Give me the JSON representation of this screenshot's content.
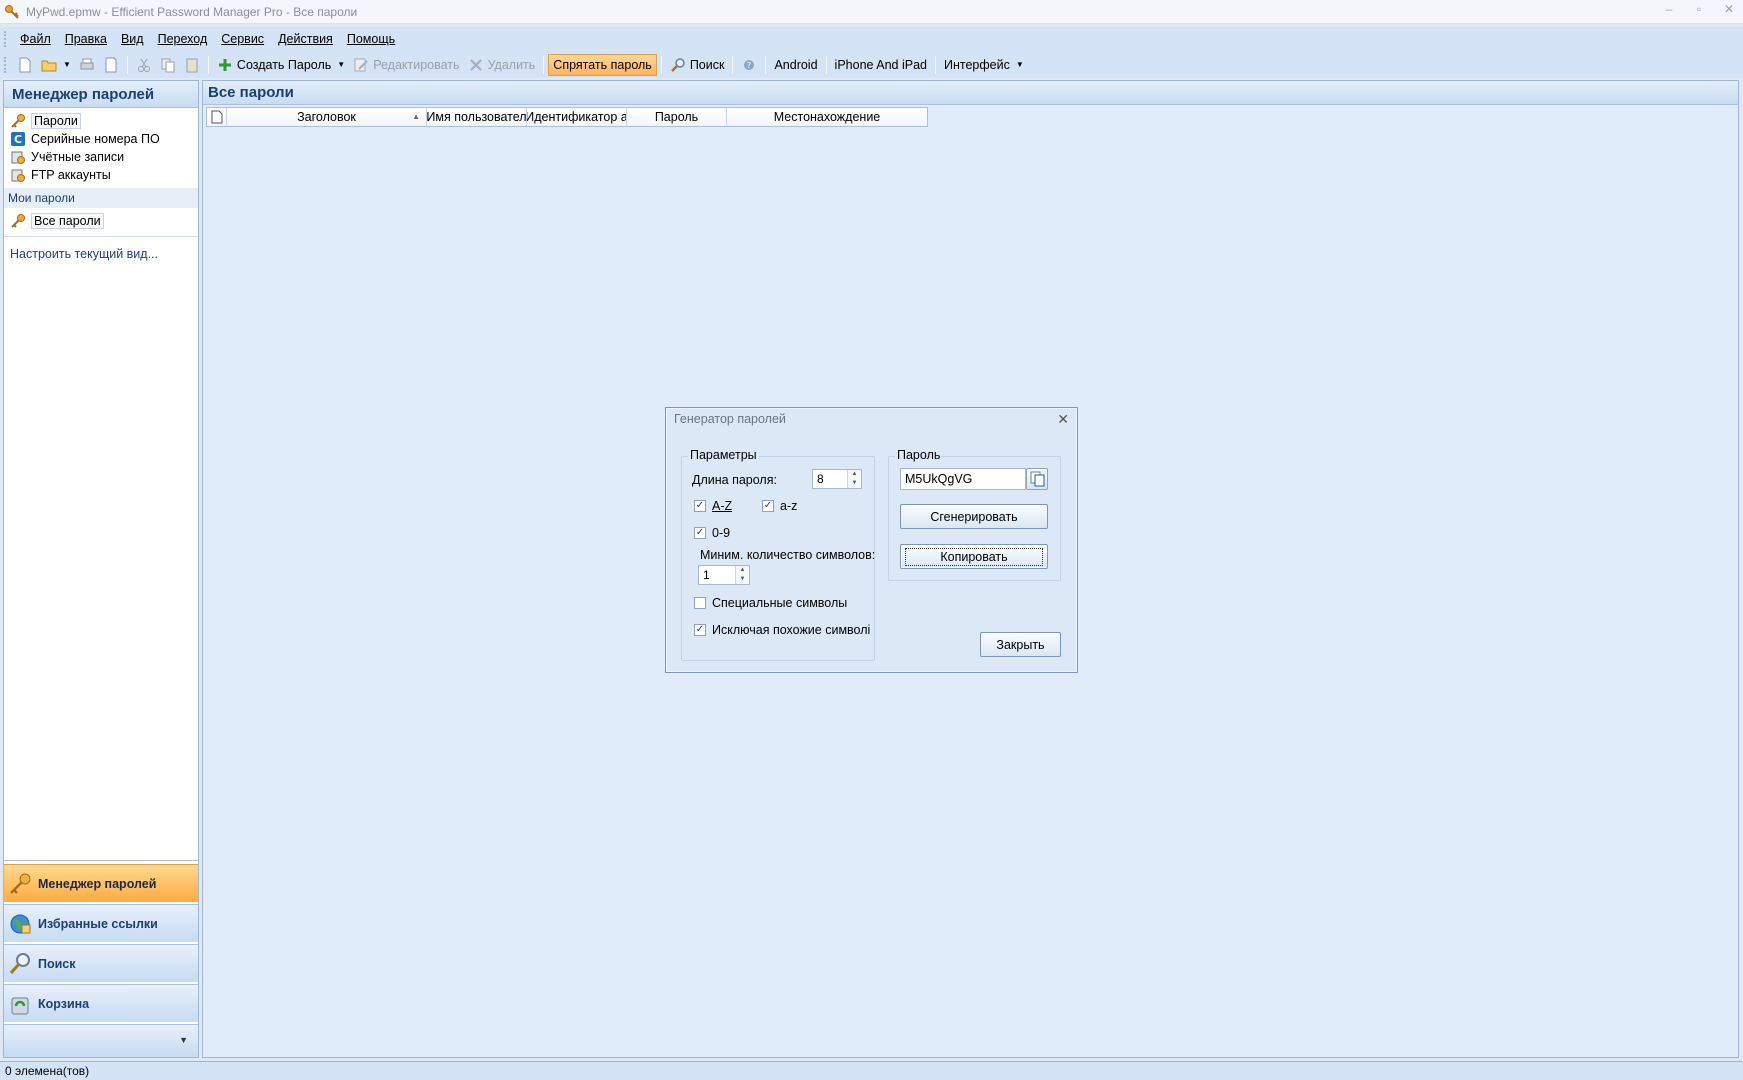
{
  "window": {
    "title": "MyPwd.epmw - Efficient Password Manager Pro - Все пароли"
  },
  "menu": [
    "Файл",
    "Правка",
    "Вид",
    "Переход",
    "Сервис",
    "Действия",
    "Помощь"
  ],
  "toolbar": {
    "create": "Создать Пароль",
    "edit": "Редактировать",
    "delete": "Удалить",
    "hide": "Спрятать пароль",
    "search": "Поиск",
    "android": "Android",
    "iphone": "iPhone And iPad",
    "interface": "Интерфейс"
  },
  "sidebar": {
    "header": "Менеджер паролей",
    "items": [
      "Пароли",
      "Серийные номера ПО",
      "Учётные записи",
      "FTP аккаунты"
    ],
    "section": "Мои пароли",
    "section_items": [
      "Все пароли"
    ],
    "config_link": "Настроить текущий вид...",
    "nav": [
      "Менеджер паролей",
      "Избранные ссылки",
      "Поиск",
      "Корзина"
    ]
  },
  "main": {
    "header": "Все пароли",
    "columns": [
      "Заголовок",
      "Имя пользовател",
      "Идентификатор а",
      "Пароль",
      "Местонахождение"
    ]
  },
  "status": "0 элемена(тов)",
  "dialog": {
    "title": "Генератор паролей",
    "params_group": "Параметры",
    "length_label": "Длина пароля:",
    "length_value": "8",
    "upper": "A-Z",
    "lower": "a-z",
    "digits": "0-9",
    "min_label": "Миним. количество символов:",
    "min_value": "1",
    "special": "Специальные символы",
    "exclude_similar": "Исключая похожие символі",
    "password_group": "Пароль",
    "password_value": "M5UkQgVG",
    "generate": "Сгенерировать",
    "copy": "Копировать",
    "close": "Закрыть",
    "checks": {
      "upper": true,
      "lower": true,
      "digits": true,
      "special": false,
      "exclude_similar": true
    }
  },
  "colors": {
    "accent": "#ffb35b",
    "header_text": "#1a3f72",
    "frame": "#d4e3f5"
  }
}
